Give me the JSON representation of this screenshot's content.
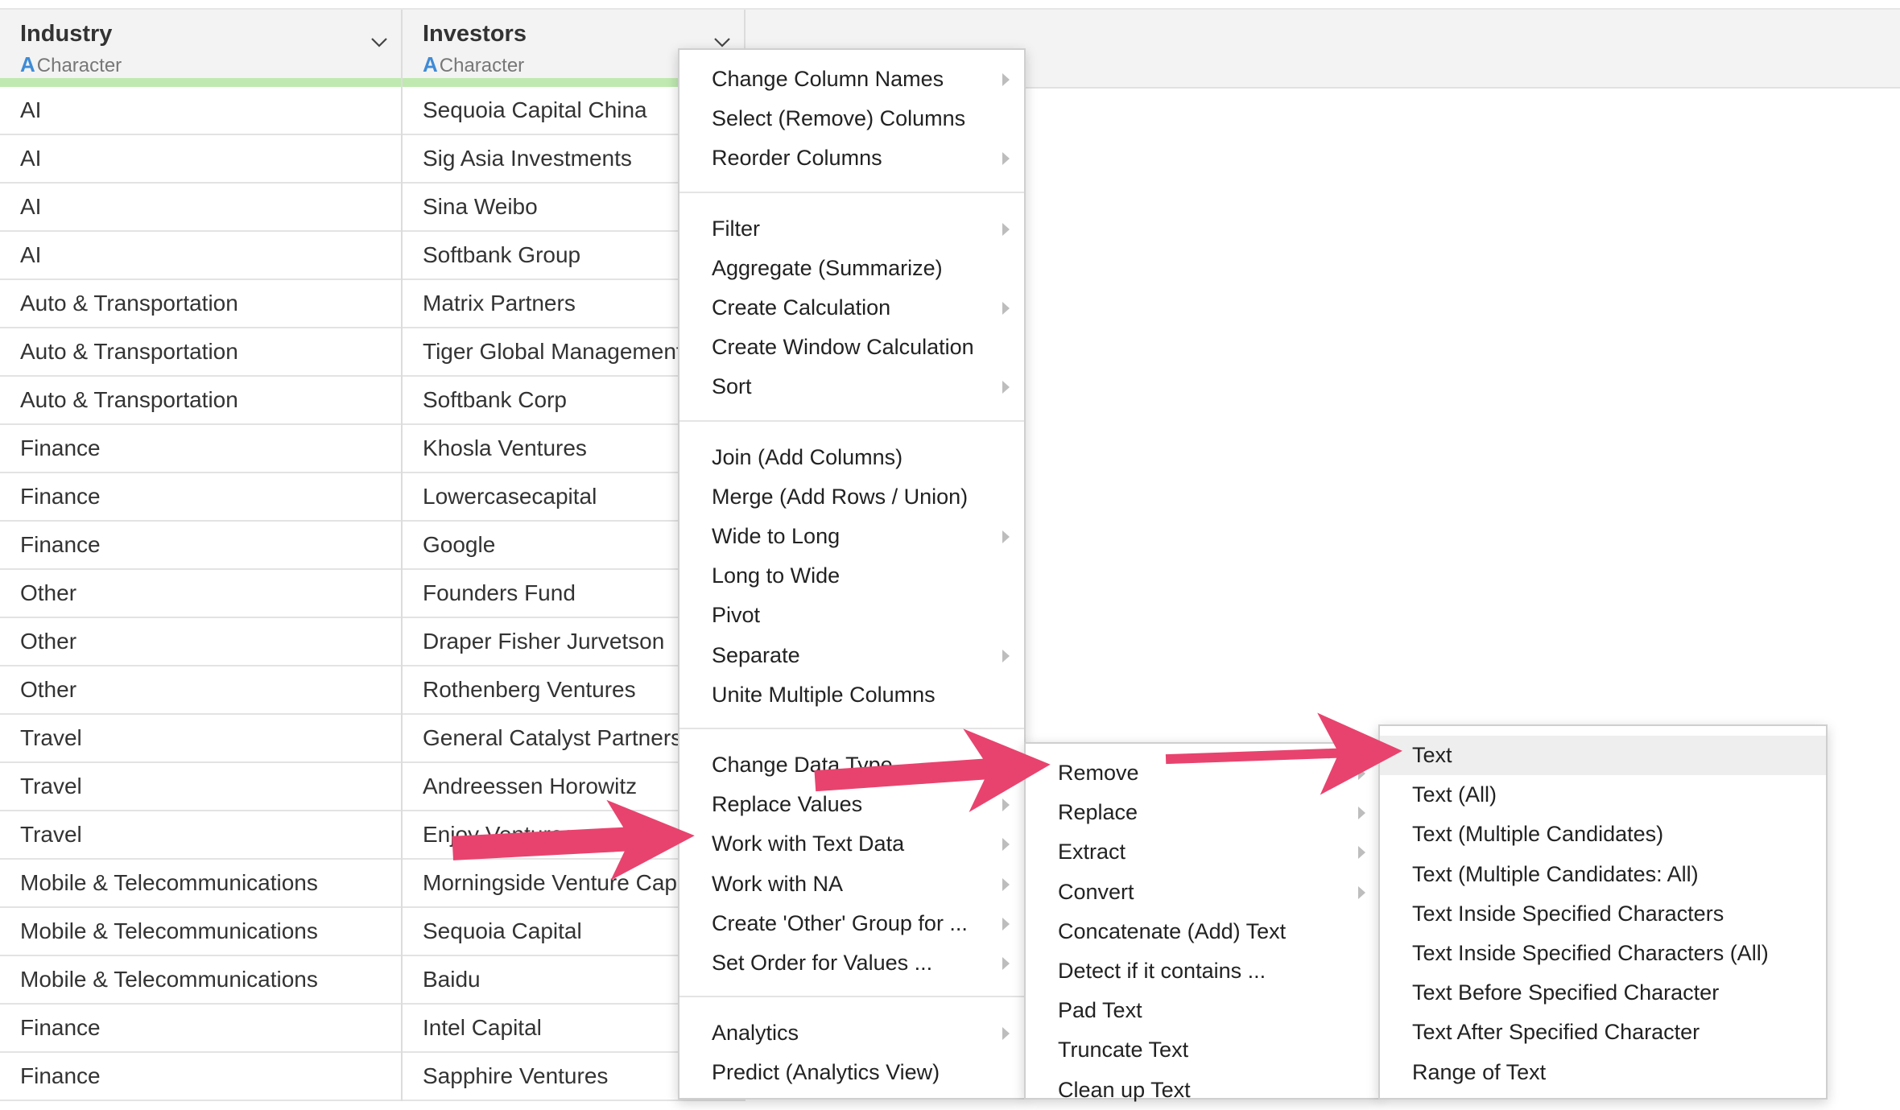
{
  "columns": [
    {
      "name": "Industry",
      "type_icon": "A",
      "type": "Character"
    },
    {
      "name": "Investors",
      "type_icon": "A",
      "type": "Character"
    }
  ],
  "rows": [
    [
      "AI",
      "Sequoia Capital China"
    ],
    [
      "AI",
      "Sig Asia Investments"
    ],
    [
      "AI",
      "Sina Weibo"
    ],
    [
      "AI",
      "Softbank Group"
    ],
    [
      "Auto & Transportation",
      "Matrix Partners"
    ],
    [
      "Auto & Transportation",
      "Tiger Global Management"
    ],
    [
      "Auto & Transportation",
      "Softbank Corp"
    ],
    [
      "Finance",
      "Khosla Ventures"
    ],
    [
      "Finance",
      "Lowercasecapital"
    ],
    [
      "Finance",
      "Google"
    ],
    [
      "Other",
      "Founders Fund"
    ],
    [
      "Other",
      "Draper Fisher Jurvetson"
    ],
    [
      "Other",
      "Rothenberg Ventures"
    ],
    [
      "Travel",
      "General Catalyst Partners"
    ],
    [
      "Travel",
      "Andreessen Horowitz"
    ],
    [
      "Travel",
      "Enjoy Ventures"
    ],
    [
      "Mobile & Telecommunications",
      "Morningside Venture Capital"
    ],
    [
      "Mobile & Telecommunications",
      "Sequoia Capital"
    ],
    [
      "Mobile & Telecommunications",
      "Baidu"
    ],
    [
      "Finance",
      "Intel Capital"
    ],
    [
      "Finance",
      "Sapphire Ventures"
    ]
  ],
  "column_menu": {
    "groups": [
      [
        {
          "label": "Change Column Names",
          "submenu": true
        },
        {
          "label": "Select (Remove) Columns",
          "submenu": false
        },
        {
          "label": "Reorder Columns",
          "submenu": true
        }
      ],
      [
        {
          "label": "Filter",
          "submenu": true
        },
        {
          "label": "Aggregate (Summarize)",
          "submenu": false
        },
        {
          "label": "Create Calculation",
          "submenu": true
        },
        {
          "label": "Create Window Calculation",
          "submenu": false
        },
        {
          "label": "Sort",
          "submenu": true
        }
      ],
      [
        {
          "label": "Join (Add Columns)",
          "submenu": false
        },
        {
          "label": "Merge (Add Rows / Union)",
          "submenu": false
        },
        {
          "label": "Wide to Long",
          "submenu": true
        },
        {
          "label": "Long to Wide",
          "submenu": false
        },
        {
          "label": "Pivot",
          "submenu": false
        },
        {
          "label": "Separate",
          "submenu": true
        },
        {
          "label": "Unite Multiple Columns",
          "submenu": false
        }
      ],
      [
        {
          "label": "Change Data Type",
          "submenu": true
        },
        {
          "label": "Replace Values",
          "submenu": true
        },
        {
          "label": "Work with Text Data",
          "submenu": true
        },
        {
          "label": "Work with NA",
          "submenu": true
        },
        {
          "label": "Create 'Other' Group for ...",
          "submenu": true
        },
        {
          "label": "Set Order for Values ...",
          "submenu": true
        }
      ],
      [
        {
          "label": "Analytics",
          "submenu": true
        },
        {
          "label": "Predict (Analytics View)",
          "submenu": false
        }
      ]
    ]
  },
  "text_submenu": [
    {
      "label": "Remove",
      "submenu": true
    },
    {
      "label": "Replace",
      "submenu": true
    },
    {
      "label": "Extract",
      "submenu": true
    },
    {
      "label": "Convert",
      "submenu": true
    },
    {
      "label": "Concatenate (Add) Text",
      "submenu": false
    },
    {
      "label": "Detect if it contains ...",
      "submenu": false
    },
    {
      "label": "Pad Text",
      "submenu": false
    },
    {
      "label": "Truncate Text",
      "submenu": false
    },
    {
      "label": "Clean up Text",
      "submenu": false
    }
  ],
  "remove_submenu": [
    {
      "label": "Text",
      "highlighted": true
    },
    {
      "label": "Text (All)"
    },
    {
      "label": "Text (Multiple Candidates)"
    },
    {
      "label": "Text (Multiple Candidates: All)"
    },
    {
      "label": "Text Inside Specified Characters"
    },
    {
      "label": "Text Inside Specified Characters (All)"
    },
    {
      "label": "Text Before Specified Character"
    },
    {
      "label": "Text After Specified Character"
    },
    {
      "label": "Range of Text"
    }
  ],
  "colors": {
    "header_bg": "#f3f3f3",
    "type_icon": "#3f8bd6",
    "header_bar": "#bfe9b0",
    "callout_arrow": "#e8436e",
    "menu_highlight": "#eeeeee"
  }
}
